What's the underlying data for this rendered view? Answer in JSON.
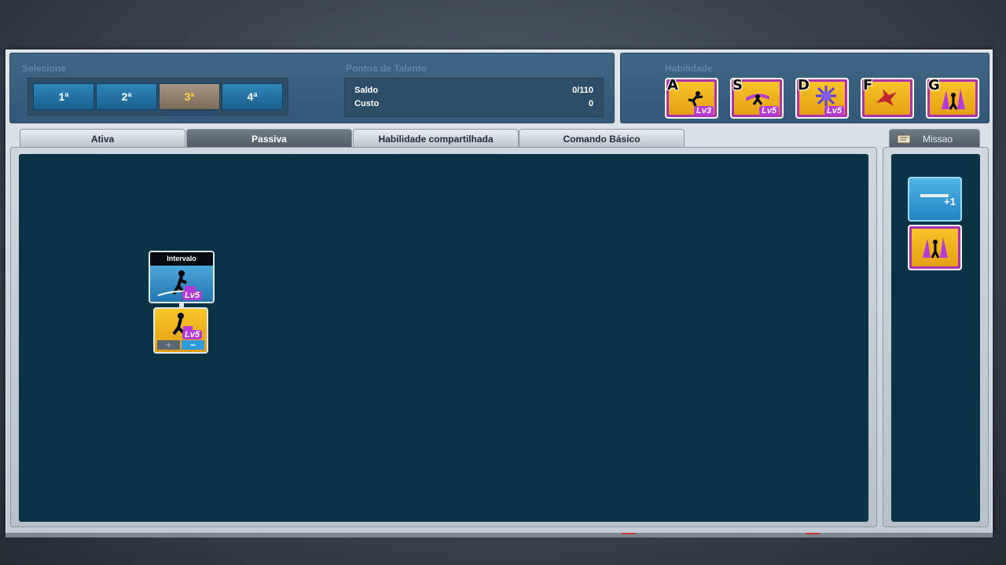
{
  "select_panel": {
    "title": "Selecione",
    "options": [
      "1ª",
      "2ª",
      "3ª",
      "4ª"
    ],
    "active_index": 2
  },
  "talent_points": {
    "title": "Pontos de Talento",
    "rows": [
      {
        "label": "Saldo",
        "value": "0/110"
      },
      {
        "label": "Custo",
        "value": "0"
      }
    ]
  },
  "skills_panel": {
    "title": "Habilidade",
    "slots": [
      {
        "key": "A",
        "level": "Lv3",
        "icon": "dash-kick-icon"
      },
      {
        "key": "S",
        "level": "Lv5",
        "icon": "purple-slash-icon"
      },
      {
        "key": "D",
        "level": "Lv5",
        "icon": "burst-icon"
      },
      {
        "key": "F",
        "level": "",
        "icon": "red-explosion-icon"
      },
      {
        "key": "G",
        "level": "",
        "icon": "purple-aura-icon"
      }
    ]
  },
  "tabs": [
    {
      "label": "Ativa",
      "active": false
    },
    {
      "label": "Passiva",
      "active": true
    },
    {
      "label": "Habilidade compartilhada",
      "active": false
    },
    {
      "label": "Comando Básico",
      "active": false
    }
  ],
  "mission_tab": {
    "label": "Missao",
    "icon": "scroll-icon"
  },
  "skill_tree": {
    "node_title": "Intervalo",
    "node_level": "Lv5",
    "icon_level": "Lv5",
    "plus_label": "+",
    "minus_label": "−"
  },
  "side_panel": {
    "bonus_label": "+1"
  },
  "colors": {
    "canvas": "#0b3346",
    "panel": "#3f6784",
    "active_option_text": "#ffd24a",
    "skill_frame": "#b02fb0"
  }
}
